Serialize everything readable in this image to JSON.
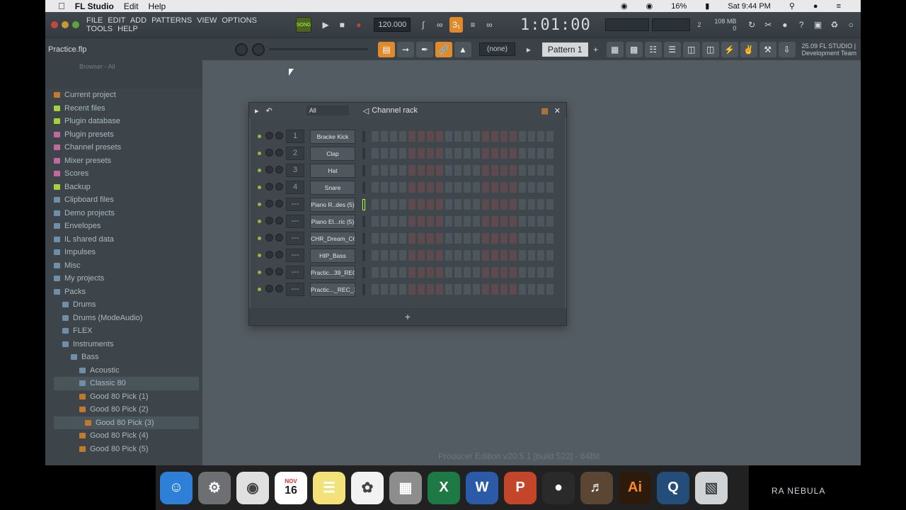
{
  "mac_menubar": {
    "app": "FL Studio",
    "items": [
      "Edit",
      "Help"
    ],
    "battery": "16%",
    "clock": "Sat 9:44 PM"
  },
  "fl_menu": [
    "FILE",
    "EDIT",
    "ADD",
    "PATTERNS",
    "VIEW",
    "OPTIONS",
    "TOOLS",
    "HELP"
  ],
  "transport": {
    "song_label": "SONG",
    "tempo": "120.000",
    "time": "1:01:00",
    "cpu_top": "108 MB",
    "cpu_bottom": "0",
    "cpu_num": "2"
  },
  "project_name": "Practice.flp",
  "selector": "(none)",
  "pattern": "Pattern 1",
  "news": {
    "line1": "25.09 FL STUDIO |",
    "line2": "Development Team"
  },
  "browser": {
    "header": "Browser - All",
    "items": [
      {
        "label": "Current project",
        "color": "#c07a2c"
      },
      {
        "label": "Recent files",
        "color": "#a6d13a"
      },
      {
        "label": "Plugin database",
        "color": "#a6d13a"
      },
      {
        "label": "Plugin presets",
        "color": "#c4679a"
      },
      {
        "label": "Channel presets",
        "color": "#c4679a"
      },
      {
        "label": "Mixer presets",
        "color": "#c4679a"
      },
      {
        "label": "Scores",
        "color": "#c4679a"
      },
      {
        "label": "Backup",
        "color": "#a6d13a"
      },
      {
        "label": "Clipboard files",
        "color": "#6f8ea8"
      },
      {
        "label": "Demo projects",
        "color": "#6f8ea8"
      },
      {
        "label": "Envelopes",
        "color": "#6f8ea8"
      },
      {
        "label": "IL shared data",
        "color": "#6f8ea8"
      },
      {
        "label": "Impulses",
        "color": "#6f8ea8"
      },
      {
        "label": "Misc",
        "color": "#6f8ea8"
      },
      {
        "label": "My projects",
        "color": "#6f8ea8"
      },
      {
        "label": "Packs",
        "color": "#6f8ea8"
      },
      {
        "label": "Drums",
        "color": "#6f8ea8"
      },
      {
        "label": "Drums (ModeAudio)",
        "color": "#6f8ea8"
      },
      {
        "label": "FLEX",
        "color": "#6f8ea8"
      },
      {
        "label": "Instruments",
        "color": "#6f8ea8"
      },
      {
        "label": "Bass",
        "color": "#6f8ea8"
      },
      {
        "label": "Acoustic",
        "color": "#6f8ea8"
      },
      {
        "label": "Classic 80",
        "color": "#6f8ea8"
      },
      {
        "label": "Good 80 Pick (1)",
        "color": "#c07a2c"
      },
      {
        "label": "Good 80 Pick (2)",
        "color": "#c07a2c"
      },
      {
        "label": "Good 80 Pick (3)",
        "color": "#c07a2c"
      },
      {
        "label": "Good 80 Pick (4)",
        "color": "#c07a2c"
      },
      {
        "label": "Good 80 Pick (5)",
        "color": "#c07a2c"
      }
    ]
  },
  "channel_rack": {
    "title": "Channel rack",
    "filter": "All",
    "channels": [
      {
        "num": "1",
        "name": "Bracke Kick"
      },
      {
        "num": "2",
        "name": "Clap"
      },
      {
        "num": "3",
        "name": "Hat"
      },
      {
        "num": "4",
        "name": "Snare"
      },
      {
        "num": "---",
        "name": "Piano R..des (5)"
      },
      {
        "num": "---",
        "name": "Piano El...ric (5)"
      },
      {
        "num": "---",
        "name": "CHR_Dream_C6"
      },
      {
        "num": "---",
        "name": "HIP_Bass"
      },
      {
        "num": "---",
        "name": "Practic...39_REC"
      },
      {
        "num": "---",
        "name": "Practic..._REC_3"
      }
    ],
    "add_label": "+"
  },
  "status_text": "Producer Edition v20.5.1 [build 522] - 64Bit",
  "dock": [
    "Finder",
    "System Preferences",
    "Chrome",
    "Calendar",
    "Notes",
    "Photos",
    "Calculator",
    "Excel",
    "Word",
    "PowerPoint",
    "FL Studio",
    "GarageBand",
    "Illustrator",
    "QuickTime",
    "Trash"
  ],
  "calendar_day": "16",
  "calendar_month": "NOV",
  "watermark": "RA NEBULA"
}
